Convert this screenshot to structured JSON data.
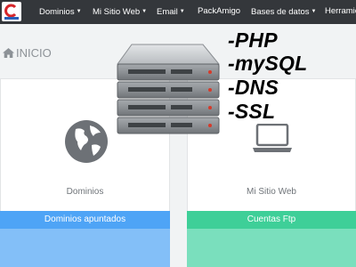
{
  "navbar": {
    "items": [
      {
        "label": "Dominios",
        "caret": true
      },
      {
        "label": "Mi Sitio Web",
        "caret": true
      },
      {
        "label": "Email",
        "caret": true
      },
      {
        "label": "PackAmigo",
        "caret": false
      },
      {
        "label": "Bases de datos",
        "caret": true
      },
      {
        "label": "Herramie",
        "caret": false
      }
    ]
  },
  "breadcrumb": {
    "label": "INICIO",
    "icon": "home-icon"
  },
  "overlay": {
    "lines": [
      "-PHP",
      "-mySQL",
      "-DNS",
      "-SSL"
    ]
  },
  "panels": [
    {
      "label": "Dominios",
      "icon": "globe-icon",
      "button_label": "Dominios apuntados",
      "button_color": "#4ea4f6",
      "foot_color": "#83bff8"
    },
    {
      "label": "Mi Sitio Web",
      "icon": "laptop-icon",
      "button_label": "Cuentas Ftp",
      "button_color": "#3ecf98",
      "foot_color": "#7adfbd"
    }
  ],
  "colors": {
    "navbar_bg": "#34373b",
    "page_bg": "#f1f3f4"
  }
}
